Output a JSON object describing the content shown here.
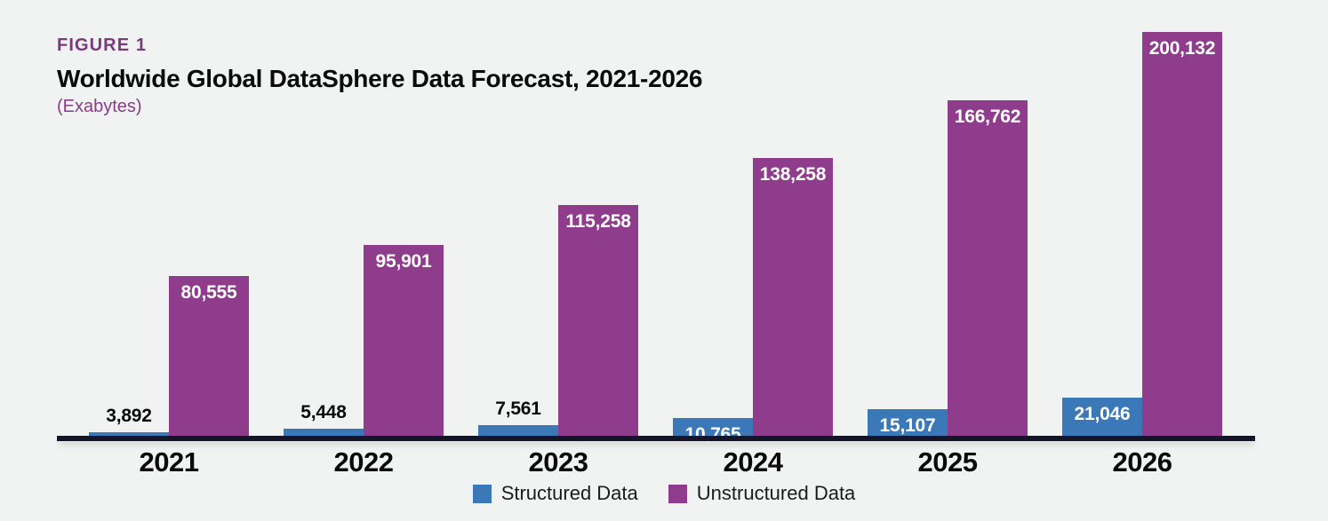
{
  "header": {
    "figure_label": "FIGURE 1",
    "title": "Worldwide Global DataSphere Data Forecast, 2021-2026",
    "subtitle": "(Exabytes)"
  },
  "colors": {
    "background": "#f1f2f2",
    "structured": "#3b78b7",
    "unstructured": "#8f3c8c",
    "accent_purple": "#7b3a7e",
    "subtitle_purple": "#8a3c87",
    "axis": "#15152a",
    "label_dark": "#0a0a0a",
    "label_light": "#ffffff"
  },
  "legend": {
    "position": "bottom-center",
    "items": [
      {
        "label": "Structured Data",
        "color": "#3b78b7",
        "swatch": "square-swatch"
      },
      {
        "label": "Unstructured Data",
        "color": "#8f3c8c",
        "swatch": "square-swatch"
      }
    ]
  },
  "chart_data": {
    "type": "bar",
    "title": "Worldwide Global DataSphere Data Forecast, 2021-2026",
    "subtitle": "(Exabytes)",
    "xlabel": "",
    "ylabel": "Exabytes",
    "grid": false,
    "ylim": [
      0,
      200132
    ],
    "categories": [
      "2021",
      "2022",
      "2023",
      "2024",
      "2025",
      "2026"
    ],
    "series": [
      {
        "name": "Structured Data",
        "color": "#3b78b7",
        "values": [
          3892,
          5448,
          7561,
          10765,
          15107,
          21046
        ],
        "labels": [
          "3,892",
          "5,448",
          "7,561",
          "10,765",
          "15,107",
          "21,046"
        ],
        "label_placement": [
          "above",
          "above",
          "above",
          "inside",
          "inside",
          "inside"
        ]
      },
      {
        "name": "Unstructured Data",
        "color": "#8f3c8c",
        "values": [
          80555,
          95901,
          115258,
          138258,
          166762,
          200132
        ],
        "labels": [
          "80,555",
          "95,901",
          "115,258",
          "138,258",
          "166,762",
          "200,132"
        ],
        "label_placement": [
          "inside",
          "inside",
          "inside",
          "inside",
          "inside",
          "inside"
        ]
      }
    ]
  }
}
